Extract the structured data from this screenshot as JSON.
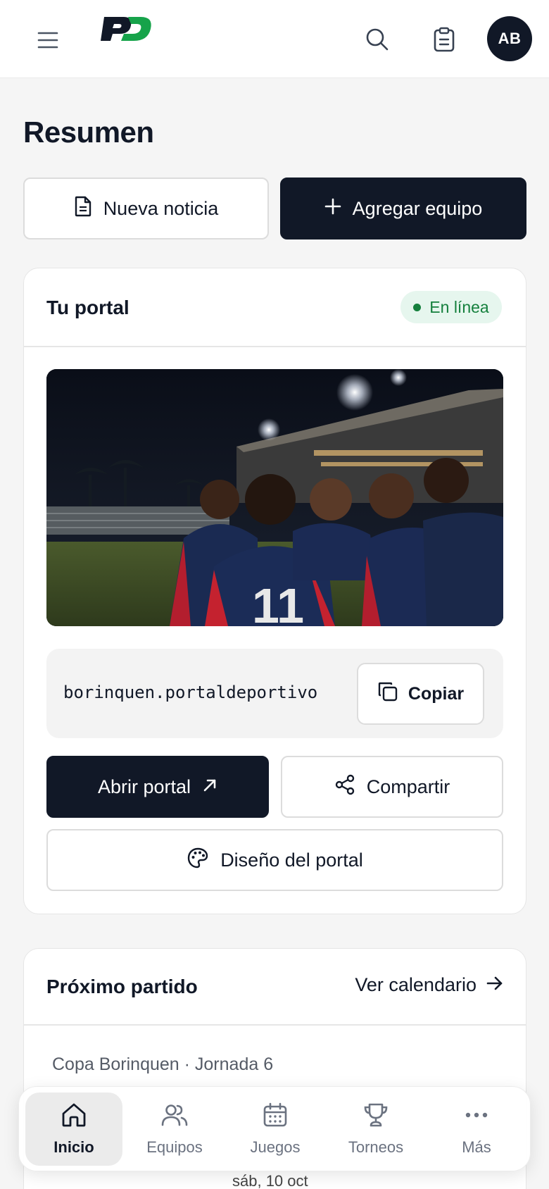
{
  "header": {
    "logo_text": "PD",
    "avatar_initials": "AB"
  },
  "page": {
    "title": "Resumen"
  },
  "actions": {
    "new_news_label": "Nueva noticia",
    "add_team_label": "Agregar equipo"
  },
  "portal": {
    "title": "Tu portal",
    "status": "En línea",
    "url": "borinquen.portaldeportivo",
    "copy_label": "Copiar",
    "open_label": "Abrir portal",
    "share_label": "Compartir",
    "design_label": "Diseño del portal"
  },
  "next_match": {
    "title": "Próximo partido",
    "calendar_link": "Ver calendario",
    "tournament": "Copa Borinquen · Jornada 6",
    "date": "sáb, 10 oct"
  },
  "bottom_nav": {
    "items": [
      {
        "label": "Inicio",
        "icon": "home-icon"
      },
      {
        "label": "Equipos",
        "icon": "users-icon"
      },
      {
        "label": "Juegos",
        "icon": "calendar-icon"
      },
      {
        "label": "Torneos",
        "icon": "trophy-icon"
      },
      {
        "label": "Más",
        "icon": "more-icon"
      }
    ]
  },
  "colors": {
    "brand_dark": "#111827",
    "brand_green": "#16a34a",
    "status_green": "#15803d"
  }
}
